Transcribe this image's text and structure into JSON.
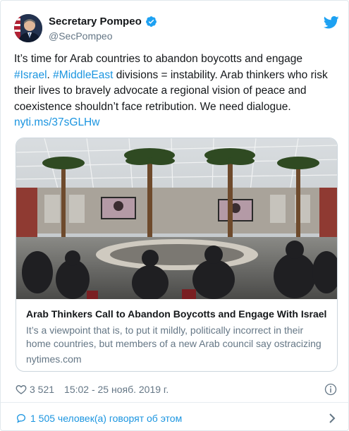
{
  "user": {
    "name": "Secretary Pompeo",
    "handle": "@SecPompeo",
    "avatar_icon": "portrait-avatar",
    "verified_icon": "verified-badge-icon"
  },
  "brand_icon": "twitter-bird-icon",
  "colors": {
    "link": "#1b95e0",
    "text": "#14171a",
    "muted": "#657786",
    "border": "#ccd6dd"
  },
  "tweet": {
    "text_before": "It’s time for Arab countries to abandon boycotts and engage ",
    "hashtag_israel": "#Israel",
    "text_between": ". ",
    "hashtag_mideast": "#MiddleEast",
    "text_after": " divisions = instability. Arab thinkers who risk their lives to bravely advocate a regional vision of peace and coexistence shouldn’t face retribution. We need dialogue.",
    "short_link": "nyti.ms/37sGLHw"
  },
  "link_card": {
    "title": "Arab Thinkers Call to Abandon Boycotts and Engage With Israel",
    "description": "It’s a viewpoint that is, to put it mildly, politically incorrect in their home countries, but members of a new Arab council say ostracizing",
    "domain": "nytimes.com"
  },
  "meta": {
    "likes": "3 521",
    "timestamp": "15:02 - 25 нояб. 2019 г."
  },
  "conversation": {
    "label": "1 505 человек(а) говорят об этом"
  }
}
